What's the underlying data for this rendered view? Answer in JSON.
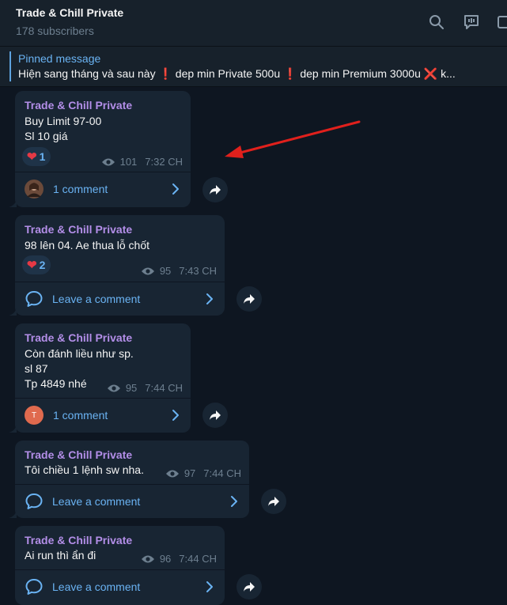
{
  "header": {
    "title": "Trade & Chill Private",
    "subscribers": "178 subscribers"
  },
  "pinned": {
    "label": "Pinned message",
    "parts": {
      "p1": "Hiện sang tháng và sau này ",
      "p2": " dep min Private 500u ",
      "p3": " dep min Premium 3000u ",
      "p4": " k..."
    }
  },
  "messages": [
    {
      "author": "Trade & Chill Private",
      "lines": [
        "Buy Limit 97-00",
        "Sl 10 giá"
      ],
      "reaction_count": "1",
      "views": "101",
      "time": "7:32 CH",
      "comment": "1 comment"
    },
    {
      "author": "Trade & Chill Private",
      "lines": [
        "98 lên 04. Ae thua lỗ chốt"
      ],
      "reaction_count": "2",
      "views": "95",
      "time": "7:43 CH",
      "comment": "Leave a comment"
    },
    {
      "author": "Trade & Chill Private",
      "lines": [
        "Còn đánh liều như sp.",
        "sl 87",
        "Tp 4849 nhé"
      ],
      "views": "95",
      "time": "7:44 CH",
      "comment": "1 comment",
      "avatar_letter": "T"
    },
    {
      "author": "Trade & Chill Private",
      "lines": [
        "Tôi chiều 1 lệnh sw nha."
      ],
      "views": "97",
      "time": "7:44 CH",
      "comment": "Leave a comment"
    },
    {
      "author": "Trade & Chill Private",
      "lines": [
        "Ai run thì ẩn đi"
      ],
      "views": "96",
      "time": "7:44 CH",
      "comment": "Leave a comment"
    }
  ],
  "icons": {
    "search": "search-icon",
    "discussion": "discussion-icon",
    "window": "window-icon",
    "eye": "eye-icon",
    "heart": "heart-icon",
    "comment": "comment-bubble-icon",
    "chevron": "chevron-right-icon",
    "share": "share-arrow-icon",
    "annotation_arrow": "red-arrow-annotation"
  },
  "colors": {
    "background": "#0e1621",
    "bubble": "#182533",
    "accent": "#6ab3f3",
    "author": "#b38ee8",
    "reaction_heart": "#e53945",
    "annotation": "#e0201c"
  }
}
